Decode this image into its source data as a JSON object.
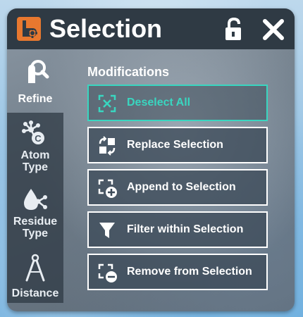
{
  "window": {
    "title": "Selection",
    "logo_icon": "app-logo-icon",
    "lock_icon": "unlock-icon",
    "close_icon": "close-icon"
  },
  "sidebar": {
    "items": [
      {
        "label": "Refine",
        "icon": "refine-magnify-icon",
        "active": true
      },
      {
        "label": "Atom\nType",
        "icon": "atom-type-icon",
        "active": false
      },
      {
        "label": "Residue\nType",
        "icon": "residue-type-icon",
        "active": false
      },
      {
        "label": "Distance",
        "icon": "distance-compass-icon",
        "active": false
      }
    ]
  },
  "main": {
    "section_title": "Modifications",
    "actions": [
      {
        "label": "Deselect All",
        "icon": "deselect-all-icon",
        "selected": true
      },
      {
        "label": "Replace Selection",
        "icon": "replace-selection-icon",
        "selected": false
      },
      {
        "label": "Append to Selection",
        "icon": "append-selection-icon",
        "selected": false
      },
      {
        "label": "Filter within Selection",
        "icon": "filter-icon",
        "selected": false
      },
      {
        "label": "Remove from Selection",
        "icon": "remove-selection-icon",
        "selected": false
      }
    ]
  },
  "colors": {
    "accent": "#39d6c0",
    "titlebar": "#2f3a44",
    "logo": "#e8782f"
  }
}
